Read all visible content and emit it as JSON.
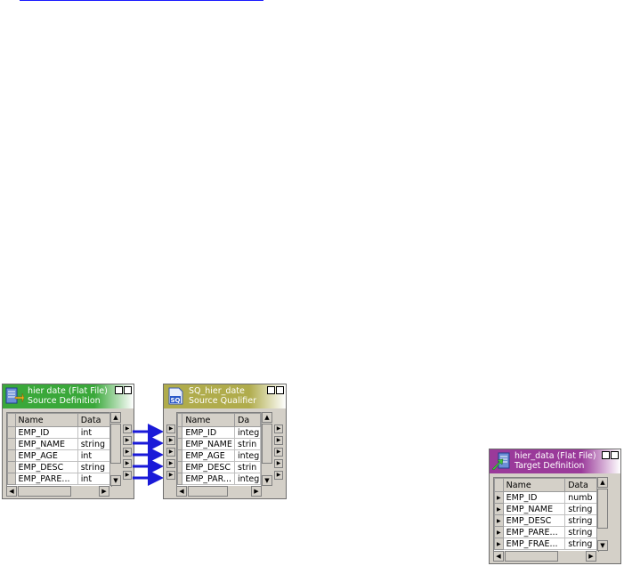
{
  "source": {
    "title": "hier date (Flat File)",
    "subtitle": "Source Definition",
    "header_color": "#3aa83a",
    "icon": "source-definition-icon",
    "columns": [
      "Name",
      "Data"
    ],
    "rows": [
      {
        "name": "EMP_ID",
        "type": "int"
      },
      {
        "name": "EMP_NAME",
        "type": "string"
      },
      {
        "name": "EMP_AGE",
        "type": "int"
      },
      {
        "name": "EMP_DESC",
        "type": "string"
      },
      {
        "name": "EMP_PARE...",
        "type": "int"
      }
    ]
  },
  "qualifier": {
    "title": "SQ_hier_date",
    "subtitle": "Source Qualifier",
    "header_color": "#b0ac4c",
    "icon": "source-qualifier-icon",
    "icon_text": "SQ",
    "columns": [
      "Name",
      "Da"
    ],
    "rows": [
      {
        "name": "EMP_ID",
        "type": "integ"
      },
      {
        "name": "EMP_NAME",
        "type": "strin"
      },
      {
        "name": "EMP_AGE",
        "type": "integ"
      },
      {
        "name": "EMP_DESC",
        "type": "strin"
      },
      {
        "name": "EMP_PAR...",
        "type": "integ"
      }
    ]
  },
  "target": {
    "title": "hier_data (Flat File)",
    "subtitle": "Target Definition",
    "header_color": "#9a3a9a",
    "icon": "target-definition-icon",
    "columns": [
      "Name",
      "Data"
    ],
    "rows": [
      {
        "name": "EMP_ID",
        "type": "numb"
      },
      {
        "name": "EMP_NAME",
        "type": "string"
      },
      {
        "name": "EMP_DESC",
        "type": "string"
      },
      {
        "name": "EMP_PARE...",
        "type": "string"
      },
      {
        "name": "EMP_FRAE...",
        "type": "string"
      }
    ]
  },
  "header_buttons": {
    "help": "?",
    "minimize": "–"
  },
  "link_color": "#1a1ad8"
}
